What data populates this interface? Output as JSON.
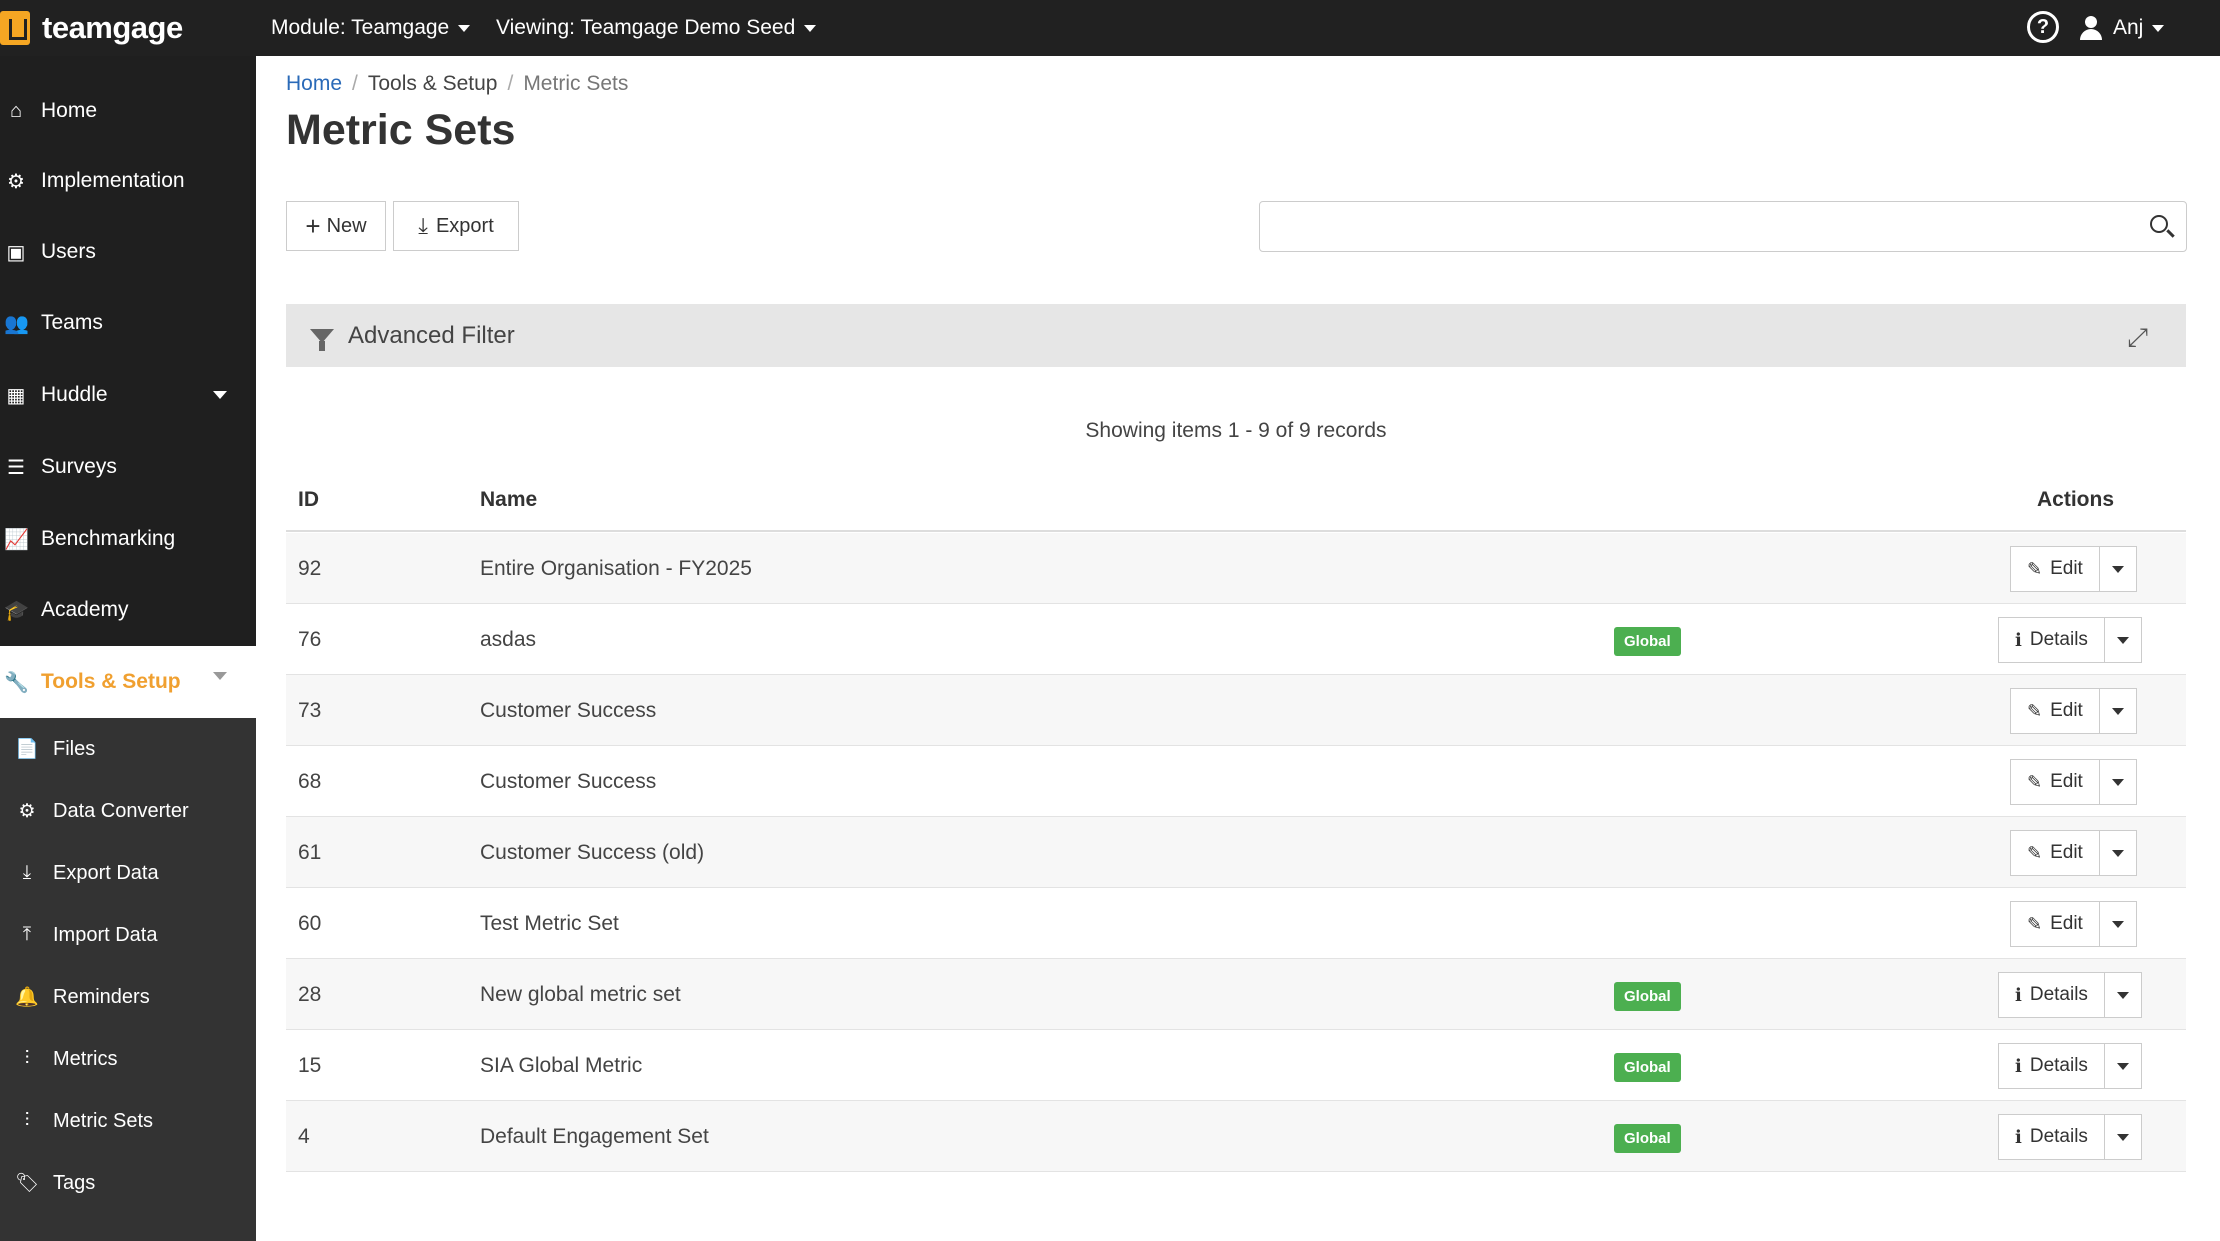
{
  "topbar": {
    "logo_text": "teamgage",
    "module_label": "Module: Teamgage",
    "viewing_label": "Viewing: Teamgage Demo Seed",
    "help_symbol": "?",
    "user_name": "Anj"
  },
  "sidebar": {
    "items": [
      {
        "label": "Home",
        "icon": "home-icon",
        "glyph": "⌂"
      },
      {
        "label": "Implementation",
        "icon": "gear-icon",
        "glyph": "⚙"
      },
      {
        "label": "Users",
        "icon": "user-card-icon",
        "glyph": "▣"
      },
      {
        "label": "Teams",
        "icon": "users-icon",
        "glyph": "👥"
      },
      {
        "label": "Huddle",
        "icon": "board-icon",
        "glyph": "▦"
      },
      {
        "label": "Surveys",
        "icon": "checklist-icon",
        "glyph": "☰"
      },
      {
        "label": "Benchmarking",
        "icon": "line-chart-icon",
        "glyph": "📈"
      },
      {
        "label": "Academy",
        "icon": "graduation-cap-icon",
        "glyph": "🎓"
      },
      {
        "label": "Tools & Setup",
        "icon": "wrench-icon",
        "glyph": "🔧"
      }
    ],
    "sub_items": [
      {
        "label": "Files",
        "icon": "file-icon",
        "glyph": "📄"
      },
      {
        "label": "Data Converter",
        "icon": "users-cog-icon",
        "glyph": "⚙"
      },
      {
        "label": "Export Data",
        "icon": "download-icon",
        "glyph": "⤓"
      },
      {
        "label": "Import Data",
        "icon": "upload-icon",
        "glyph": "⤒"
      },
      {
        "label": "Reminders",
        "icon": "bell-icon",
        "glyph": "🔔"
      },
      {
        "label": "Metrics",
        "icon": "sliders-icon",
        "glyph": "⫶"
      },
      {
        "label": "Metric Sets",
        "icon": "sliders-icon",
        "glyph": "⫶"
      },
      {
        "label": "Tags",
        "icon": "tags-icon",
        "glyph": "🏷"
      }
    ]
  },
  "breadcrumb": {
    "home": "Home",
    "section": "Tools & Setup",
    "current": "Metric Sets",
    "separator": "/"
  },
  "page": {
    "title": "Metric Sets",
    "new_label": "New",
    "export_label": "Export",
    "search_placeholder": "",
    "filter_label": "Advanced Filter",
    "showing_text": "Showing items 1 - 9 of 9 records"
  },
  "table": {
    "columns": {
      "id": "ID",
      "name": "Name",
      "actions": "Actions"
    },
    "rows": [
      {
        "id": "92",
        "name": "Entire Organisation - FY2025",
        "badge": "",
        "action": "Edit"
      },
      {
        "id": "76",
        "name": "asdas",
        "badge": "Global",
        "action": "Details"
      },
      {
        "id": "73",
        "name": "Customer Success",
        "badge": "",
        "action": "Edit"
      },
      {
        "id": "68",
        "name": "Customer Success",
        "badge": "",
        "action": "Edit"
      },
      {
        "id": "61",
        "name": "Customer Success (old)",
        "badge": "",
        "action": "Edit"
      },
      {
        "id": "60",
        "name": "Test Metric Set",
        "badge": "",
        "action": "Edit"
      },
      {
        "id": "28",
        "name": "New global metric set",
        "badge": "Global",
        "action": "Details"
      },
      {
        "id": "15",
        "name": "SIA Global Metric",
        "badge": "Global",
        "action": "Details"
      },
      {
        "id": "4",
        "name": "Default Engagement Set",
        "badge": "Global",
        "action": "Details"
      }
    ]
  },
  "colors": {
    "topbar": "#212121",
    "sidebar": "#1f1f1f",
    "accent": "#f0a030",
    "link": "#2a6ab8",
    "badge": "#4caf50"
  }
}
